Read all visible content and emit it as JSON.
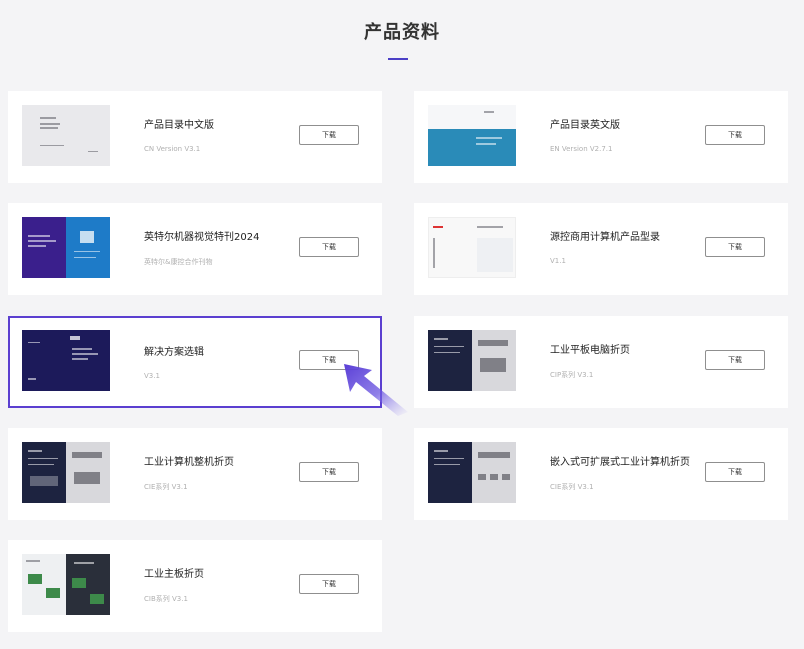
{
  "section": {
    "title": "产品资料"
  },
  "colors": {
    "accent": "#4b3fc6",
    "active_border": "#5b3fd0"
  },
  "cards": [
    {
      "title": "产品目录中文版",
      "subtitle": "CN Version V3.1",
      "button": "下载",
      "thumb": "gray-doc"
    },
    {
      "title": "产品目录英文版",
      "subtitle": "EN Version V2.7.1",
      "button": "下载",
      "thumb": "white-blue-doc"
    },
    {
      "title": "英特尔机器视觉特刊2024",
      "subtitle": "英特尔&康控合作刊物",
      "button": "下载",
      "thumb": "purple-blue-doc"
    },
    {
      "title": "源控商用计算机产品型录",
      "subtitle": "V1.1",
      "button": "下载",
      "thumb": "white-doc"
    },
    {
      "title": "解决方案选辑",
      "subtitle": "V3.1",
      "button": "下载",
      "thumb": "navy-doc"
    },
    {
      "title": "工业平板电脑折页",
      "subtitle": "CIP系列 V3.1",
      "button": "下载",
      "thumb": "navy-gray-doc"
    },
    {
      "title": "工业计算机整机折页",
      "subtitle": "CIE系列 V3.1",
      "button": "下载",
      "thumb": "navy-gray-doc"
    },
    {
      "title": "嵌入式可扩展式工业计算机折页",
      "subtitle": "CIE系列 V3.1",
      "button": "下载",
      "thumb": "navy-gray-doc"
    },
    {
      "title": "工业主板折页",
      "subtitle": "CIB系列 V3.1",
      "button": "下载",
      "thumb": "light-dark-doc"
    }
  ]
}
